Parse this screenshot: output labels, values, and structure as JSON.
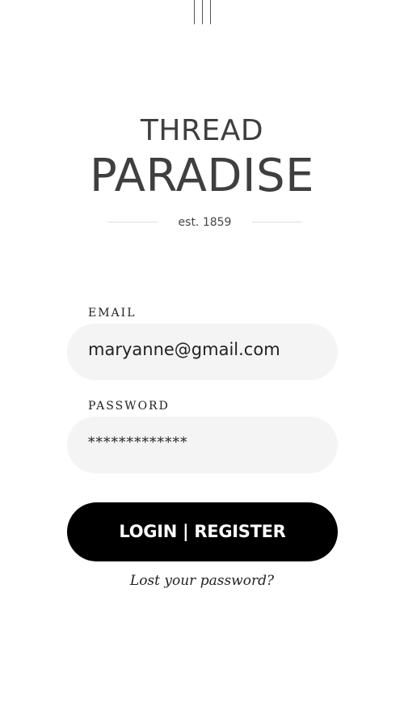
{
  "header": {
    "icon": "three-vertical-lines-icon"
  },
  "brand": {
    "line1": "THREAD",
    "line2": "PARADISE",
    "established": "est. 1859"
  },
  "form": {
    "email_label": "EMAIL",
    "email_value": "maryanne@gmail.com",
    "password_label": "PASSWORD",
    "password_value": "*************",
    "submit_label": "LOGIN | REGISTER",
    "lost_password_label": "Lost your password?"
  },
  "colors": {
    "background": "#ffffff",
    "field_background": "#f4f4f4",
    "button_background": "#000000",
    "button_text": "#ffffff",
    "brand_text": "#3f3f3f"
  }
}
